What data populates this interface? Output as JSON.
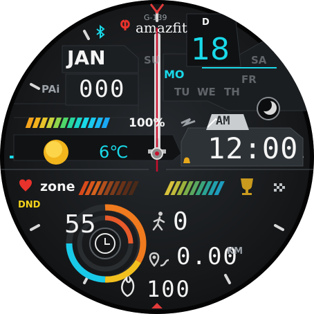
{
  "brand": {
    "model": "G-139",
    "name": "amazfit"
  },
  "bezel": {
    "top_letter": "D"
  },
  "date": {
    "month": "JAN",
    "day": "18",
    "weekdays": [
      "SU",
      "MO",
      "TU",
      "WE",
      "TH",
      "FR",
      "SA"
    ],
    "active_weekday": "MO"
  },
  "pai": {
    "label": "PAi",
    "value": "000"
  },
  "battery": {
    "percent_text": "100%",
    "level": 1.0
  },
  "weather": {
    "icon": "sun-icon",
    "temperature": "6℃"
  },
  "time": {
    "ampm": "AM",
    "display": "12:00"
  },
  "heart": {
    "label": "zone",
    "dnd": "DND"
  },
  "activity": {
    "value": "55"
  },
  "steps": {
    "value": "0"
  },
  "distance": {
    "value": "0.00",
    "unit": "KM"
  },
  "calories": {
    "value": "100"
  },
  "colors": {
    "accent": "#19d9e8",
    "hand": "#c8102e",
    "warn": "#e8322b",
    "gold": "#f4c31c"
  }
}
